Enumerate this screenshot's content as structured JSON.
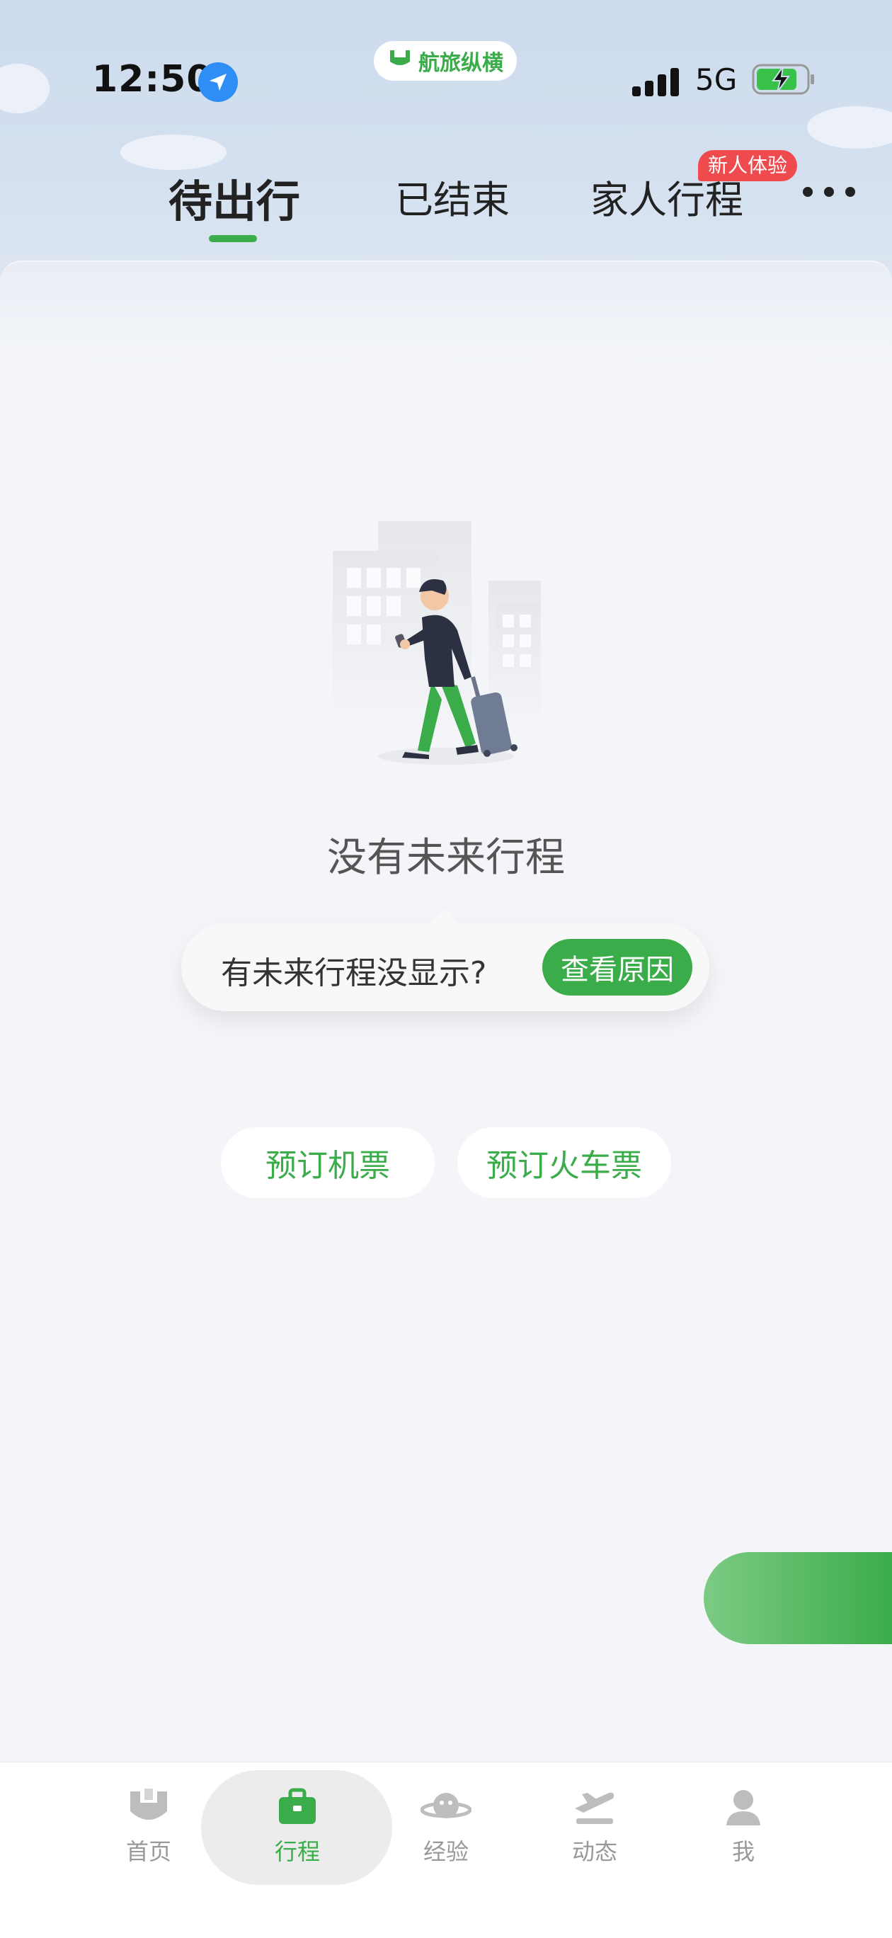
{
  "status_bar": {
    "time": "12:50",
    "network": "5G",
    "app_pill_label": "航旅纵横"
  },
  "tabs": [
    {
      "label": "待出行",
      "active": true
    },
    {
      "label": "已结束",
      "active": false
    },
    {
      "label": "家人行程",
      "active": false,
      "badge": "新人体验"
    }
  ],
  "empty_state": {
    "title": "没有未来行程",
    "tip_text": "有未来行程没显示?",
    "tip_button": "查看原因"
  },
  "actions": [
    {
      "label": "预订机票"
    },
    {
      "label": "预订火车票"
    }
  ],
  "bottom_nav": [
    {
      "label": "首页",
      "icon": "home-logo-icon",
      "active": false
    },
    {
      "label": "行程",
      "icon": "briefcase-icon",
      "active": true
    },
    {
      "label": "经验",
      "icon": "planet-icon",
      "active": false
    },
    {
      "label": "动态",
      "icon": "plane-takeoff-icon",
      "active": false
    },
    {
      "label": "我",
      "icon": "person-icon",
      "active": false
    }
  ],
  "colors": {
    "accent": "#3aac4a",
    "badge": "#ef4b4f",
    "location": "#2f8ef5"
  }
}
